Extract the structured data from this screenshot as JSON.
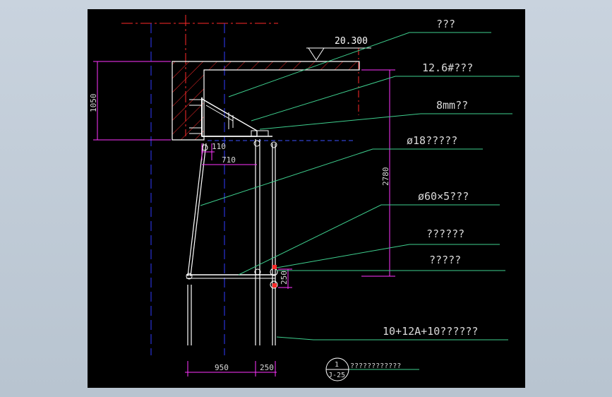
{
  "colors": {
    "background": "#000000",
    "frame": "#c3cdd8",
    "structure": "#ffffff",
    "axis_red": "#ff2a2a",
    "axis_blue": "#2f3cff",
    "dimension": "#ff33ff",
    "leader": "#3ecf8e",
    "hatch": "#ff2a2a",
    "text": "#d9d9d9",
    "elevation": "#ffffff"
  },
  "elevation": {
    "value": "20.300",
    "symbol": "elevation-triangle-icon"
  },
  "dimensions": {
    "height_left": "1050",
    "height_right": "2780",
    "bracket_small": "110",
    "bracket_width": "710",
    "spacing_small": "250",
    "bottom_left": "950",
    "bottom_right": "250"
  },
  "callouts": [
    {
      "label": "???"
    },
    {
      "label": "12.6#???"
    },
    {
      "label": "8mm??"
    },
    {
      "label": "ø18?????"
    },
    {
      "label": "ø60×5???"
    },
    {
      "label": "??????"
    },
    {
      "label": "?????"
    },
    {
      "label": "10+12A+10??????"
    }
  ],
  "detail_tag": {
    "number": "1",
    "sheet": "J-25",
    "title": "????????????"
  }
}
